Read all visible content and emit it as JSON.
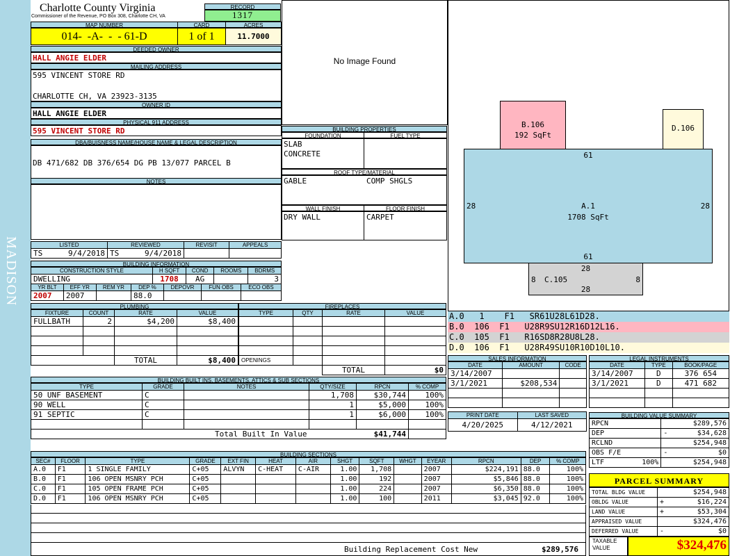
{
  "county": {
    "name": "Charlotte County Virginia",
    "subtitle": "Commissioner of the Revenue, PO Box 308, Charlotte CH, VA"
  },
  "sidebar_label": "MADISON",
  "record": {
    "label": "RECORD",
    "value": "1317"
  },
  "map_number": {
    "label": "MAP NUMBER",
    "value": "014-  -A-  -  - 61-D"
  },
  "card": {
    "label": "CARD",
    "value": "1 of 1"
  },
  "acres": {
    "label": "ACRES",
    "value": "11.7000"
  },
  "deeded_owner": {
    "label": "DEEDED OWNER",
    "value": "HALL ANGIE ELDER"
  },
  "mailing_address": {
    "label": "MAILING ADDRESS",
    "line1": "595 VINCENT STORE RD",
    "line2": "CHARLOTTE CH, VA 23923-3135"
  },
  "owner_id": {
    "label": "OWNER ID",
    "value": "HALL ANGIE ELDER"
  },
  "physical_address": {
    "label": "PHYSICAL 911 ADDRESS",
    "value": "595 VINCENT STORE RD"
  },
  "legal": {
    "label": "DBA/BUISNESS NAME/HOUSE NAME & LEGAL DESCRIPTION",
    "value": "DB 471/682 DB 376/654 DG PB 13/077 PARCEL B"
  },
  "notes": {
    "label": "NOTES",
    "value": ""
  },
  "image": {
    "placeholder": "No Image Found"
  },
  "building_properties": {
    "label": "BUILDING PROPERTIES",
    "foundation_label": "FOUNDATION",
    "fuel_label": "FUEL TYPE",
    "foundation": [
      "SLAB",
      "CONCRETE"
    ],
    "fuel": "",
    "roof_label": "ROOF TYPE/MATERIAL",
    "roof_type": "GABLE",
    "roof_material": "COMP SHGLS",
    "wall_label": "WALL FINISH",
    "floor_label": "FLOOR FINISH",
    "wall": "DRY WALL",
    "floor": "CARPET"
  },
  "listed": {
    "listed_label": "LISTED",
    "reviewed_label": "REVIEWED",
    "revisit_label": "REVISIT",
    "appeals_label": "APPEALS",
    "listed_by": "TS",
    "listed_date": "9/4/2018",
    "reviewed_by": "TS",
    "reviewed_date": "9/4/2018"
  },
  "building_info": {
    "label": "BUILDING INFORMATION",
    "style_label": "CONSTRUCTION STYLE",
    "hsqft_label": "H SQFT",
    "cond_label": "COND",
    "rooms_label": "ROOMS",
    "bdrms_label": "BDRMS",
    "style": "DWELLING",
    "hsqft": "1708",
    "cond": "AG",
    "rooms": "",
    "bdrms": "3",
    "yrblt_label": "YR BLT",
    "effyr_label": "EFF YR",
    "remyr_label": "REM YR",
    "dep_label": "DEP %",
    "depovr_label": "DEPOVR",
    "funobs_label": "FUN OBS",
    "ecoobs_label": "ECO OBS",
    "yrblt": "2007",
    "effyr": "2007",
    "dep": "88.0"
  },
  "plumbing": {
    "label": "PLUMBING",
    "headers": [
      "FIXTURE",
      "COUNT",
      "RATE",
      "VALUE"
    ],
    "rows": [
      [
        "FULLBATH",
        "2",
        "$4,200",
        "$8,400"
      ]
    ],
    "total_label": "TOTAL",
    "total": "$8,400"
  },
  "fireplaces": {
    "label": "FIREPLACES",
    "headers": [
      "TYPE",
      "QTY",
      "RATE",
      "VALUE"
    ],
    "openings_label": "OPENINGS",
    "total_label": "TOTAL",
    "total": "$0"
  },
  "built_ins": {
    "label": "BUILDING BUILT INS, BASEMENTS, ATTICS & SUB SECTIONS",
    "headers": [
      "TYPE",
      "GRADE",
      "NOTES",
      "QTY/SIZE",
      "RPCN",
      "% COMP"
    ],
    "rows": [
      [
        "50 UNF BASEMENT",
        "C",
        "",
        "1,708",
        "$30,744",
        "100%"
      ],
      [
        "90 WELL",
        "C",
        "",
        "1",
        "$5,000",
        "100%"
      ],
      [
        "91 SEPTIC",
        "C",
        "",
        "1",
        "$6,000",
        "100%"
      ]
    ],
    "total_label": "Total Built In Value",
    "total": "$41,744"
  },
  "sections": {
    "label": "BUILDING SECTIONS",
    "headers": [
      "SEC#",
      "FLOOR",
      "TYPE",
      "GRADE",
      "EXT FIN",
      "HEAT",
      "AIR",
      "SHGT",
      "SQFT",
      "WHGT",
      "EYEAR",
      "RPCN",
      "DEP",
      "% COMP"
    ],
    "rows": [
      [
        "A.0",
        "F1",
        "1 SINGLE FAMILY",
        "C+05",
        "ALVYN",
        "C-HEAT",
        "C-AIR",
        "1.00",
        "1,708",
        "",
        "2007",
        "$224,191",
        "88.0",
        "100%"
      ],
      [
        "B.0",
        "F1",
        "106 OPEN MSNRY PCH",
        "C+05",
        "",
        "",
        "",
        "1.00",
        "192",
        "",
        "2007",
        "$5,846",
        "88.0",
        "100%"
      ],
      [
        "C.0",
        "F1",
        "105 OPEN FRAME PCH",
        "C+05",
        "",
        "",
        "",
        "1.00",
        "224",
        "",
        "2007",
        "$6,350",
        "88.0",
        "100%"
      ],
      [
        "D.0",
        "F1",
        "106 OPEN MSNRY PCH",
        "C+05",
        "",
        "",
        "",
        "1.00",
        "100",
        "",
        "2011",
        "$3,045",
        "92.0",
        "100%"
      ]
    ],
    "total_label": "Building Replacement Cost New",
    "total": "$289,576"
  },
  "sketch": {
    "a_label": "A.1",
    "a_area": "1708 SqFt",
    "a_top": "61",
    "a_bottom": "61",
    "a_left": "28",
    "a_right": "28",
    "b_label": "B.106",
    "b_area": "192 SqFt",
    "c_label": "C.105",
    "c_top": "28",
    "c_bottom": "28",
    "c_left": "8",
    "c_right": "8",
    "d_label": "D.106",
    "colors": {
      "A": "#add8e6",
      "B": "#ffb6c1",
      "C": "#d3d3d3",
      "D": "#fffadc"
    }
  },
  "sketch_codes": [
    [
      "A.0",
      "1",
      "F1",
      "SR61U28L61D28."
    ],
    [
      "B.0",
      "106",
      "F1",
      "U28R9SU12R16D12L16."
    ],
    [
      "C.0",
      "105",
      "F1",
      "R16SD8R28U8L28."
    ],
    [
      "D.0",
      "106",
      "F1",
      "U28R49SU10R10D10L10."
    ]
  ],
  "sales": {
    "label": "SALES INFORMATION",
    "headers": [
      "DATE",
      "AMOUNT",
      "CODE"
    ],
    "rows": [
      [
        "3/14/2007",
        "",
        ""
      ],
      [
        "3/1/2021",
        "$208,534",
        ""
      ]
    ]
  },
  "legal_instruments": {
    "label": "LEGAL INSTRUMENTS",
    "headers": [
      "DATE",
      "TYPE",
      "BOOK/PAGE"
    ],
    "rows": [
      [
        "3/14/2007",
        "D",
        "376 654"
      ],
      [
        "3/1/2021",
        "D",
        "471 682"
      ]
    ]
  },
  "print": {
    "print_label": "PRINT DATE",
    "saved_label": "LAST SAVED",
    "print_date": "4/20/2025",
    "last_saved": "4/12/2021"
  },
  "value_summary": {
    "label": "BUILDING VALUE SUMMARY",
    "rows": [
      [
        "RPCN",
        "",
        "$289,576"
      ],
      [
        "DEP",
        "-",
        "$34,628"
      ],
      [
        "RCLND",
        "",
        "$254,948"
      ],
      [
        "OBS F/E",
        "-",
        "$0"
      ],
      [
        "LTF         100%",
        "",
        "$254,948"
      ]
    ]
  },
  "parcel_summary": {
    "label": "PARCEL SUMMARY",
    "rows": [
      [
        "TOTAL BLDG VALUE",
        "",
        "$254,948"
      ],
      [
        "OBLDG VALUE",
        "+",
        "$16,224"
      ],
      [
        "LAND VALUE",
        "+",
        "$53,304"
      ],
      [
        "APPRAISED VALUE",
        "",
        "$324,476"
      ],
      [
        "DEFERRED VALUE",
        "-",
        "$0"
      ]
    ],
    "taxable_label": "TAXABLE VALUE",
    "taxable": "$324,476"
  }
}
